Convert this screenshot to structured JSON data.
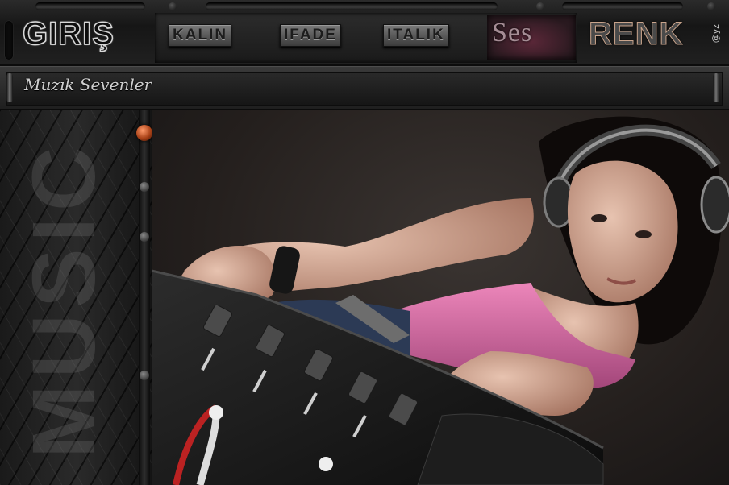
{
  "header": {
    "logo_text": "GIRIŞ",
    "menu": [
      {
        "label": "KALIN"
      },
      {
        "label": "IFADE"
      },
      {
        "label": "ITALIK"
      }
    ],
    "ses_label": "Ses",
    "renk_label": "RENK",
    "renk_tag": "@yz"
  },
  "titlebar": {
    "site_title": "Muzık Sevenler"
  },
  "left_column": {
    "vertical_text": "MUSIC"
  },
  "colors": {
    "led": "#c24e1c",
    "tank_top": "#e06aa8",
    "background": "#1a1a1a"
  },
  "hero": {
    "image_subject": "dj-mixing-console"
  }
}
